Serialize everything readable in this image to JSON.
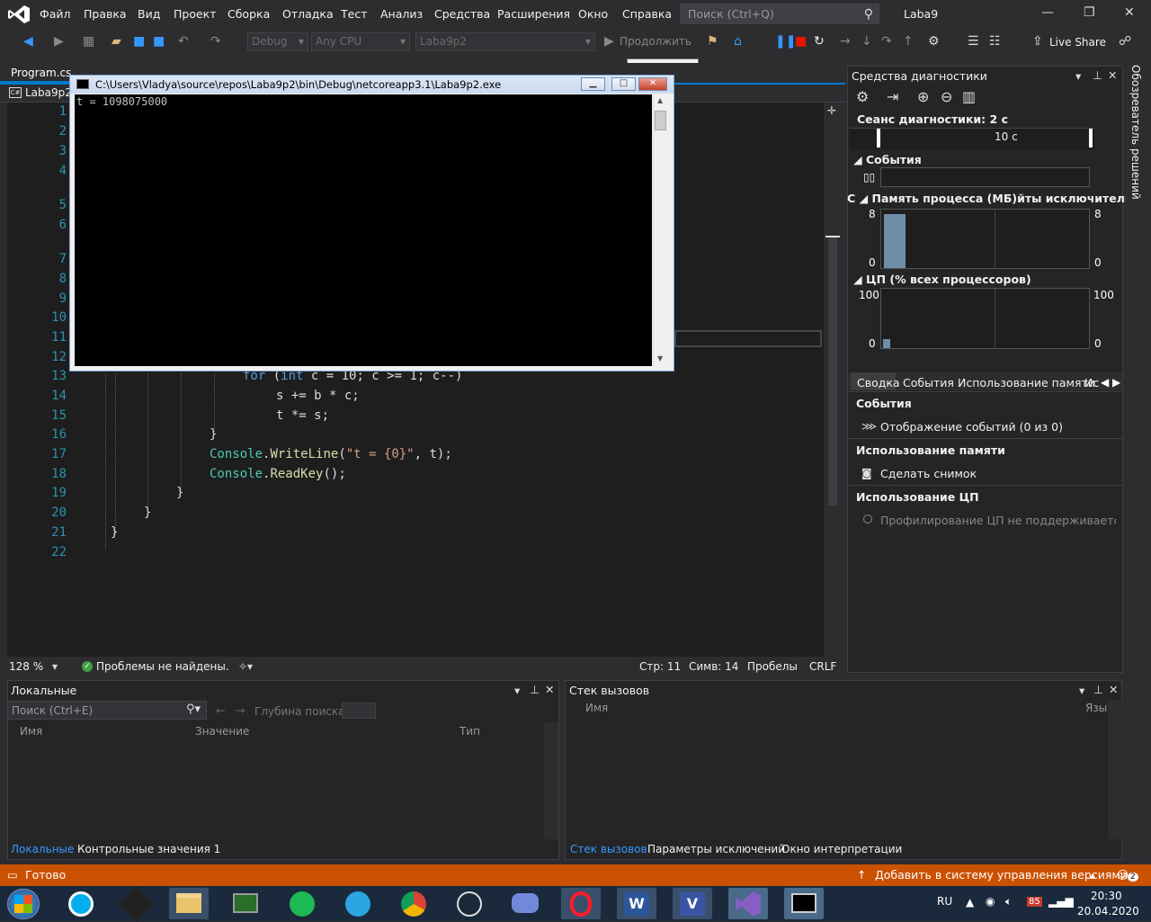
{
  "menu": {
    "items": [
      "Файл",
      "Правка",
      "Вид",
      "Проект",
      "Сборка",
      "Отладка",
      "Тест",
      "Анализ",
      "Средства",
      "Расширения",
      "Окно",
      "Справка"
    ],
    "search_placeholder": "Поиск (Ctrl+Q)",
    "solution_name": "Laba9"
  },
  "toolbar": {
    "config": "Debug",
    "platform": "Any CPU",
    "project": "Laba9p2",
    "continue_label": "Продолжить",
    "live_share": "Live Share",
    "tooltip": "Продолжить"
  },
  "editor": {
    "tab_label": "Program.cs",
    "nav_file": "Laba9p2",
    "line_numbers": [
      "1",
      "2",
      "3",
      "4",
      "5",
      "6",
      "7",
      "8",
      "9",
      "10",
      "11",
      "12",
      "13",
      "14",
      "15",
      "16",
      "17",
      "18",
      "19",
      "20",
      "21",
      "22"
    ],
    "code": {
      "l13_kw": "for",
      "l13_rest": " (",
      "l13_int": "int",
      "l13_tail": " c = 10; c >= 1; c--)",
      "l14": "s += b * c;",
      "l15": "t *= s;",
      "l16": "}",
      "l17_cls": "Console",
      "l17_dot": ".",
      "l17_mth": "WriteLine",
      "l17_open": "(",
      "l17_str": "\"t = {0}\"",
      "l17_rest": ", t);",
      "l18_cls": "Console",
      "l18_dot": ".",
      "l18_mth": "ReadKey",
      "l18_rest": "();",
      "l19": "}",
      "l20": "}",
      "l21": "}"
    },
    "status": {
      "zoom": "128 %",
      "problems": "Проблемы не найдены.",
      "line": "Стр: 11",
      "col": "Симв: 14",
      "spaces": "Пробелы",
      "eol": "CRLF"
    }
  },
  "console": {
    "title": "C:\\Users\\Vladya\\source\\repos\\Laba9p2\\bin\\Debug\\netcoreapp3.1\\Laba9p2.exe",
    "output": "t = 1098075000"
  },
  "diagnostics": {
    "title": "Средства диагностики",
    "session": "Сеанс диагностики: 2 с",
    "timeline_label": "10 с",
    "events_header": "События",
    "memory_header": "Память процесса (МБ)йты исключительног...",
    "memory_c_prefix": "С",
    "memory_max": "8",
    "memory_min": "0",
    "cpu_header": "ЦП (% всех процессоров)",
    "cpu_max": "100",
    "cpu_min": "0",
    "tabs": [
      "Сводка",
      "События",
      "Использование памяти",
      "Ис"
    ],
    "section_events": "События",
    "show_events": "Отображение событий (0 из 0)",
    "section_memory": "Использование памяти",
    "take_snapshot": "Сделать снимок",
    "section_cpu": "Использование ЦП",
    "cpu_profiling": "Профилирование ЦП не поддерживается в да",
    "solution_explorer": "Обозреватель решений"
  },
  "locals": {
    "title": "Локальные",
    "search_placeholder": "Поиск (Ctrl+E)",
    "depth_label": "Глубина поиска:",
    "col_name": "Имя",
    "col_value": "Значение",
    "col_type": "Тип",
    "tab_locals": "Локальные",
    "tab_watch": "Контрольные значения 1"
  },
  "callstack": {
    "title": "Стек вызовов",
    "col_name": "Имя",
    "col_lang": "Язык",
    "tab_callstack": "Стек вызовов",
    "tab_exceptions": "Параметры исключений",
    "tab_immediate": "Окно интерпретации"
  },
  "status": {
    "ready": "Готово",
    "source_control": "Добавить в систему управления версиями",
    "notifications": "2"
  },
  "taskbar": {
    "lang": "RU",
    "time": "20:30",
    "date": "20.04.2020",
    "badge": "85"
  }
}
